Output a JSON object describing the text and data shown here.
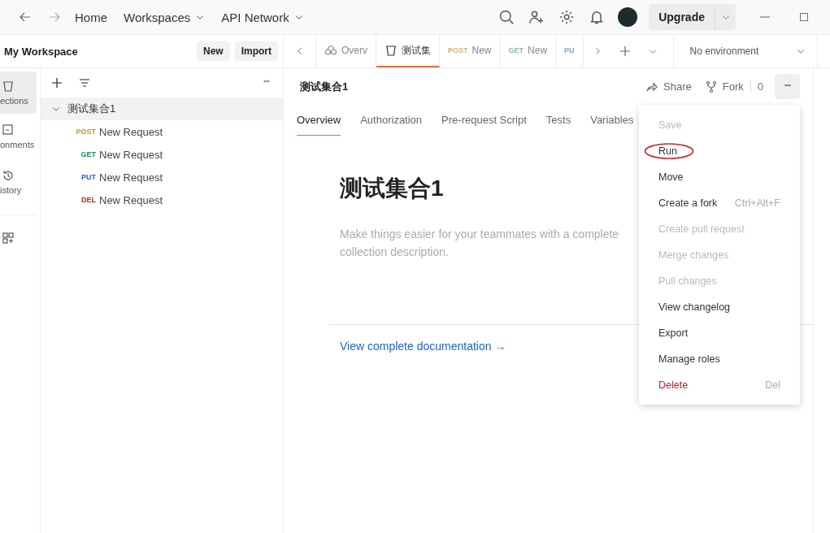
{
  "topbar": {
    "home": "Home",
    "menus": [
      {
        "label": "Workspaces"
      },
      {
        "label": "API Network"
      }
    ],
    "upgrade": "Upgrade"
  },
  "workspace": {
    "name": "My Workspace",
    "buttons": [
      "New",
      "Import"
    ]
  },
  "rail": [
    {
      "label": "ections",
      "selected": true
    },
    {
      "label": "onments",
      "selected": false
    },
    {
      "label": "istory",
      "selected": false
    },
    {
      "selected": false
    }
  ],
  "tree": {
    "name": "测试集合1",
    "expanded": true,
    "selected": true,
    "children": [
      {
        "method": "POST",
        "color": "#c8961c",
        "name": "New Request"
      },
      {
        "method": "GET",
        "color": "#1f8a52",
        "name": "New Request"
      },
      {
        "method": "PUT",
        "color": "#2d63c8",
        "name": "New Request"
      },
      {
        "method": "DEL",
        "color": "#b3262f",
        "name": "New Request"
      }
    ]
  },
  "tabs": [
    {
      "kind": "overview",
      "label": "Overv",
      "selected": false
    },
    {
      "kind": "collection",
      "label": "测试集",
      "selected": true
    },
    {
      "kind": "request",
      "method": "POST",
      "color": "#d8b070",
      "label": "New",
      "selected": false
    },
    {
      "kind": "request",
      "method": "GET",
      "color": "#7fbf9c",
      "label": "New",
      "selected": false
    },
    {
      "kind": "request",
      "method": "PU",
      "color": "#7fa3d8",
      "selected": false
    }
  ],
  "environment": "No environment",
  "header": {
    "title": "测试集合1",
    "share": "Share",
    "fork": "Fork",
    "fork_count": "0"
  },
  "subtabs": [
    {
      "label": "Overview",
      "selected": true
    },
    {
      "label": "Authorization",
      "selected": false
    },
    {
      "label": "Pre-request Script",
      "selected": false
    },
    {
      "label": "Tests",
      "selected": false
    },
    {
      "label": "Variables",
      "selected": false
    }
  ],
  "overview": {
    "title": "测试集合1",
    "placeholder_lines": [
      "Make things easier for your teammates with a complete",
      "collection description."
    ],
    "link": "View complete documentation →"
  },
  "menu": [
    {
      "label": "Save",
      "disabled": true,
      "circled": false
    },
    {
      "label": "Run",
      "disabled": false,
      "circled": true
    },
    {
      "label": "Move",
      "disabled": false,
      "circled": false
    },
    {
      "label": "Create a fork",
      "shortcut": "Ctrl+Alt+F",
      "disabled": false,
      "circled": false
    },
    {
      "label": "Create pull request",
      "disabled": true,
      "circled": false
    },
    {
      "label": "Merge changes",
      "disabled": true,
      "circled": false
    },
    {
      "label": "Pull changes",
      "disabled": true,
      "circled": false
    },
    {
      "label": "View changelog",
      "disabled": false,
      "circled": false
    },
    {
      "label": "Export",
      "disabled": false,
      "circled": false
    },
    {
      "label": "Manage roles",
      "disabled": false,
      "circled": false
    },
    {
      "label": "Delete",
      "kind": "danger",
      "shortcut": "Del",
      "disabled": false,
      "circled": false
    }
  ]
}
